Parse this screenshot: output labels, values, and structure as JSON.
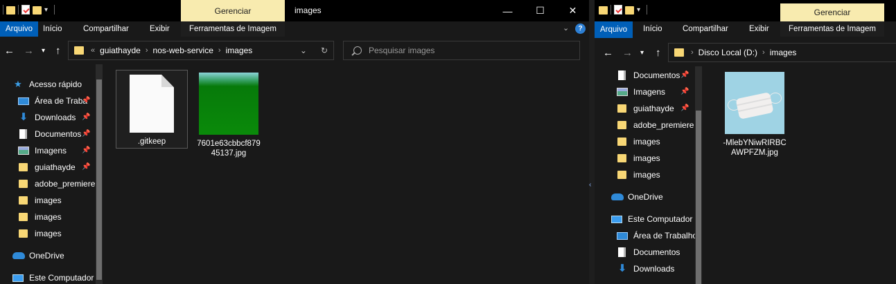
{
  "left": {
    "ribbon_context": "Gerenciar",
    "title": "images",
    "tabs": [
      "Arquivo",
      "Início",
      "Compartilhar",
      "Exibir",
      "Ferramentas de Imagem"
    ],
    "breadcrumb": [
      "guiathayde",
      "nos-web-service",
      "images"
    ],
    "breadcrumb_overflow": "«",
    "search_placeholder": "Pesquisar images",
    "window_buttons": {
      "minimize": "—",
      "maximize": "☐",
      "close": "✕"
    },
    "nav": [
      {
        "label": "Acesso rápido",
        "icon": "star-icon"
      },
      {
        "label": "Área de Traba",
        "icon": "desktop-icon",
        "pinned": true
      },
      {
        "label": "Downloads",
        "icon": "download-icon",
        "pinned": true
      },
      {
        "label": "Documentos",
        "icon": "documents-icon",
        "pinned": true
      },
      {
        "label": "Imagens",
        "icon": "images-icon",
        "pinned": true
      },
      {
        "label": "guiathayde",
        "icon": "folder-icon",
        "pinned": true
      },
      {
        "label": "adobe_premiere",
        "icon": "folder-icon"
      },
      {
        "label": "images",
        "icon": "folder-icon"
      },
      {
        "label": "images",
        "icon": "folder-icon"
      },
      {
        "label": "images",
        "icon": "folder-icon"
      },
      {
        "label": "OneDrive",
        "icon": "onedrive-icon"
      },
      {
        "label": "Este Computador",
        "icon": "computer-icon"
      }
    ],
    "files": [
      {
        "name": ".gitkeep",
        "kind": "generic-file-icon"
      },
      {
        "name": "7601e63cbbcf87945137.jpg",
        "kind": "green-image-thumbnail"
      }
    ]
  },
  "right": {
    "ribbon_context": "Gerenciar",
    "tabs": [
      "Arquivo",
      "Início",
      "Compartilhar",
      "Exibir",
      "Ferramentas de Imagem"
    ],
    "breadcrumb": [
      "Disco Local (D:)",
      "images"
    ],
    "nav": [
      {
        "label": "Documentos",
        "icon": "documents-icon",
        "pinned": true
      },
      {
        "label": "Imagens",
        "icon": "images-icon",
        "pinned": true
      },
      {
        "label": "guiathayde",
        "icon": "folder-icon",
        "pinned": true
      },
      {
        "label": "adobe_premiere",
        "icon": "folder-icon"
      },
      {
        "label": "images",
        "icon": "folder-icon"
      },
      {
        "label": "images",
        "icon": "folder-icon"
      },
      {
        "label": "images",
        "icon": "folder-icon"
      },
      {
        "label": "OneDrive",
        "icon": "onedrive-icon"
      },
      {
        "label": "Este Computador",
        "icon": "computer-icon"
      },
      {
        "label": "Área de Trabalho",
        "icon": "desktop-icon"
      },
      {
        "label": "Documentos",
        "icon": "documents-icon"
      },
      {
        "label": "Downloads",
        "icon": "download-icon"
      }
    ],
    "files": [
      {
        "name": "-MlebYNiwRIRBCAWPFZM.jpg",
        "kind": "mask-image-thumbnail"
      }
    ]
  },
  "colors": {
    "accent": "#005fb8",
    "context_tab": "#f8ebaf",
    "folder": "#f8d775",
    "background": "#191919"
  }
}
